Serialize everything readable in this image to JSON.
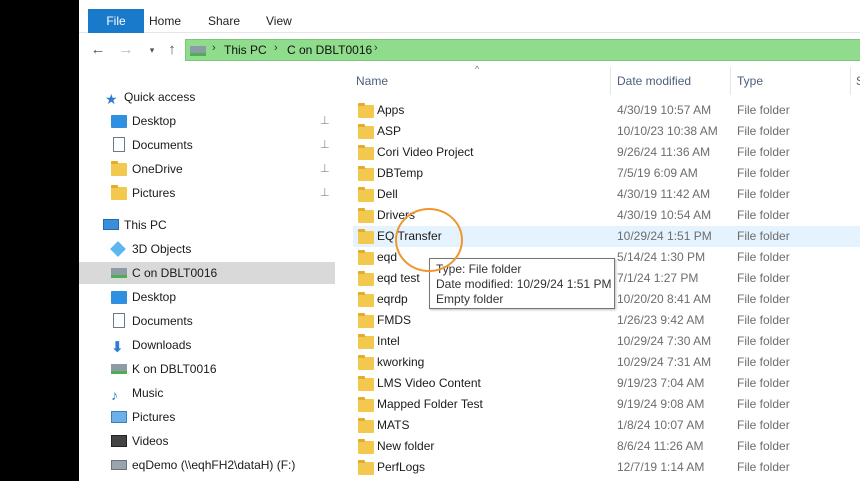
{
  "ribbon": {
    "tabs": [
      "File",
      "Home",
      "Share",
      "View"
    ]
  },
  "address": {
    "crumbs": [
      "This PC",
      "C on DBLT0016"
    ],
    "separator": "›"
  },
  "nav_icons": {
    "back": "←",
    "forward": "→",
    "recent": "▾",
    "up": "↑"
  },
  "navpane": {
    "quick_access": "Quick access",
    "quick_items": [
      "Desktop",
      "Documents",
      "OneDrive",
      "Pictures"
    ],
    "pin_glyph": "📌",
    "this_pc": "This PC",
    "pc_items": [
      "3D Objects",
      "C on DBLT0016",
      "Desktop",
      "Documents",
      "Downloads",
      "K on DBLT0016",
      "Music",
      "Pictures",
      "Videos",
      "eqDemo (\\\\eqhFH2\\dataH) (F:)"
    ]
  },
  "columns": {
    "name": "Name",
    "date": "Date modified",
    "type": "Type",
    "size": "S",
    "sort_glyph": "^"
  },
  "files": [
    {
      "name": "Apps",
      "date": "4/30/19 10:57 AM",
      "type": "File folder"
    },
    {
      "name": "ASP",
      "date": "10/10/23 10:38 AM",
      "type": "File folder"
    },
    {
      "name": "Cori Video Project",
      "date": "9/26/24 11:36 AM",
      "type": "File folder"
    },
    {
      "name": "DBTemp",
      "date": "7/5/19 6:09 AM",
      "type": "File folder"
    },
    {
      "name": "Dell",
      "date": "4/30/19 11:42 AM",
      "type": "File folder"
    },
    {
      "name": "Drivers",
      "date": "4/30/19 10:54 AM",
      "type": "File folder"
    },
    {
      "name": "EQ Transfer",
      "date": "10/29/24 1:51 PM",
      "type": "File folder"
    },
    {
      "name": "eqd",
      "date": "5/14/24 1:30 PM",
      "type": "File folder"
    },
    {
      "name": "eqd test",
      "date": "7/1/24 1:27 PM",
      "type": "File folder"
    },
    {
      "name": "eqrdp",
      "date": "10/20/20 8:41 AM",
      "type": "File folder"
    },
    {
      "name": "FMDS",
      "date": "1/26/23 9:42 AM",
      "type": "File folder"
    },
    {
      "name": "Intel",
      "date": "10/29/24 7:30 AM",
      "type": "File folder"
    },
    {
      "name": "kworking",
      "date": "10/29/24 7:31 AM",
      "type": "File folder"
    },
    {
      "name": "LMS Video Content",
      "date": "9/19/23 7:04 AM",
      "type": "File folder"
    },
    {
      "name": "Mapped Folder Test",
      "date": "9/19/24 9:08 AM",
      "type": "File folder"
    },
    {
      "name": "MATS",
      "date": "1/8/24 10:07 AM",
      "type": "File folder"
    },
    {
      "name": "New folder",
      "date": "8/6/24 11:26 AM",
      "type": "File folder"
    },
    {
      "name": "PerfLogs",
      "date": "12/7/19 1:14 AM",
      "type": "File folder"
    }
  ],
  "tooltip": {
    "line1": "Type: File folder",
    "line2": "Date modified: 10/29/24 1:51 PM",
    "line3": "Empty folder"
  }
}
